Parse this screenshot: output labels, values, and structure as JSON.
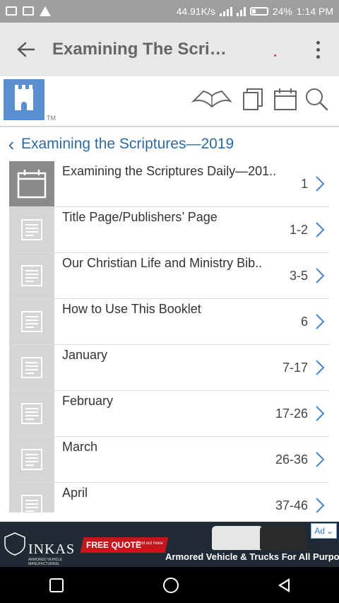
{
  "status_bar": {
    "speed": "44.91K/s",
    "battery": "24%",
    "time": "1:14 PM"
  },
  "app_bar": {
    "title": "Examining The Scri…"
  },
  "breadcrumb": {
    "label": "Examining the Scriptures—2019"
  },
  "list": {
    "items": [
      {
        "title": "Examining the Scriptures Daily—201..",
        "pages": "1",
        "icon": "calendar-icon"
      },
      {
        "title": "Title Page/Publishers’ Page",
        "pages": "1-2",
        "icon": "document-icon"
      },
      {
        "title": "Our Christian Life and Ministry Bib..",
        "pages": "3-5",
        "icon": "document-icon"
      },
      {
        "title": "How to Use This Booklet",
        "pages": "6",
        "icon": "document-icon"
      },
      {
        "title": "January",
        "pages": "7-17",
        "icon": "document-icon"
      },
      {
        "title": "February",
        "pages": "17-26",
        "icon": "document-icon"
      },
      {
        "title": "March",
        "pages": "26-36",
        "icon": "document-icon"
      },
      {
        "title": "April",
        "pages": "37-46",
        "icon": "document-icon"
      }
    ]
  },
  "ad": {
    "brand": "INKAS",
    "brand_sub": "ARMORED VEHICLE MANUFACTURING",
    "cta": "FREE QUOTE",
    "cta_small": "Find out more",
    "badge": "Ad",
    "tagline": "Armored Vehicle & Trucks For All Purposes"
  },
  "colors": {
    "accent": "#2e6a9e",
    "logo": "#5a8fcf",
    "chevron": "#4a86c5"
  }
}
